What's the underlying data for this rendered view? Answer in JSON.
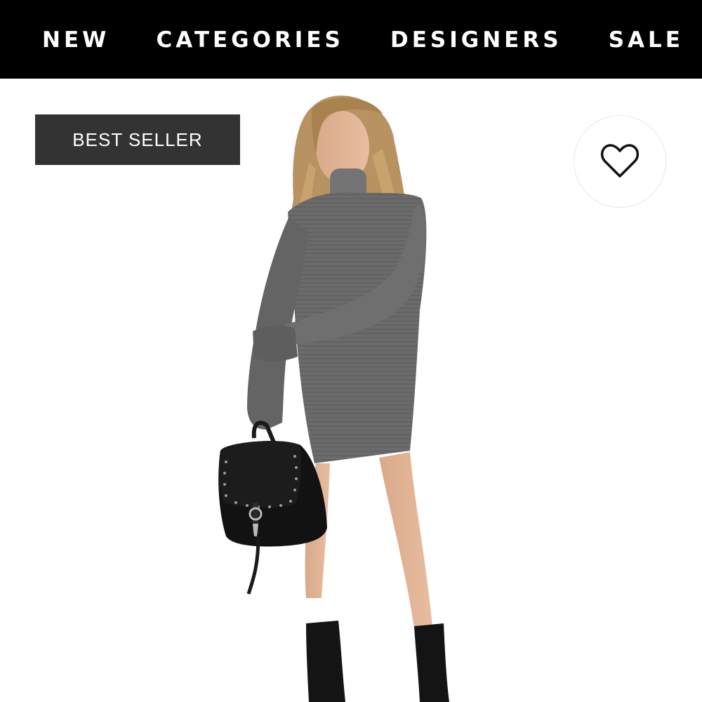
{
  "nav": {
    "items": [
      {
        "label": "NEW"
      },
      {
        "label": "CATEGORIES"
      },
      {
        "label": "DESIGNERS"
      },
      {
        "label": "SALE"
      }
    ]
  },
  "product": {
    "badge": "BEST SELLER",
    "wishlist_icon": "heart-outline-icon",
    "photo_description_icon": "product-photo"
  },
  "colors": {
    "nav_bg": "#000000",
    "nav_text": "#ffffff",
    "badge_bg": "#333333",
    "badge_text": "#ffffff",
    "page_bg": "#ffffff"
  }
}
